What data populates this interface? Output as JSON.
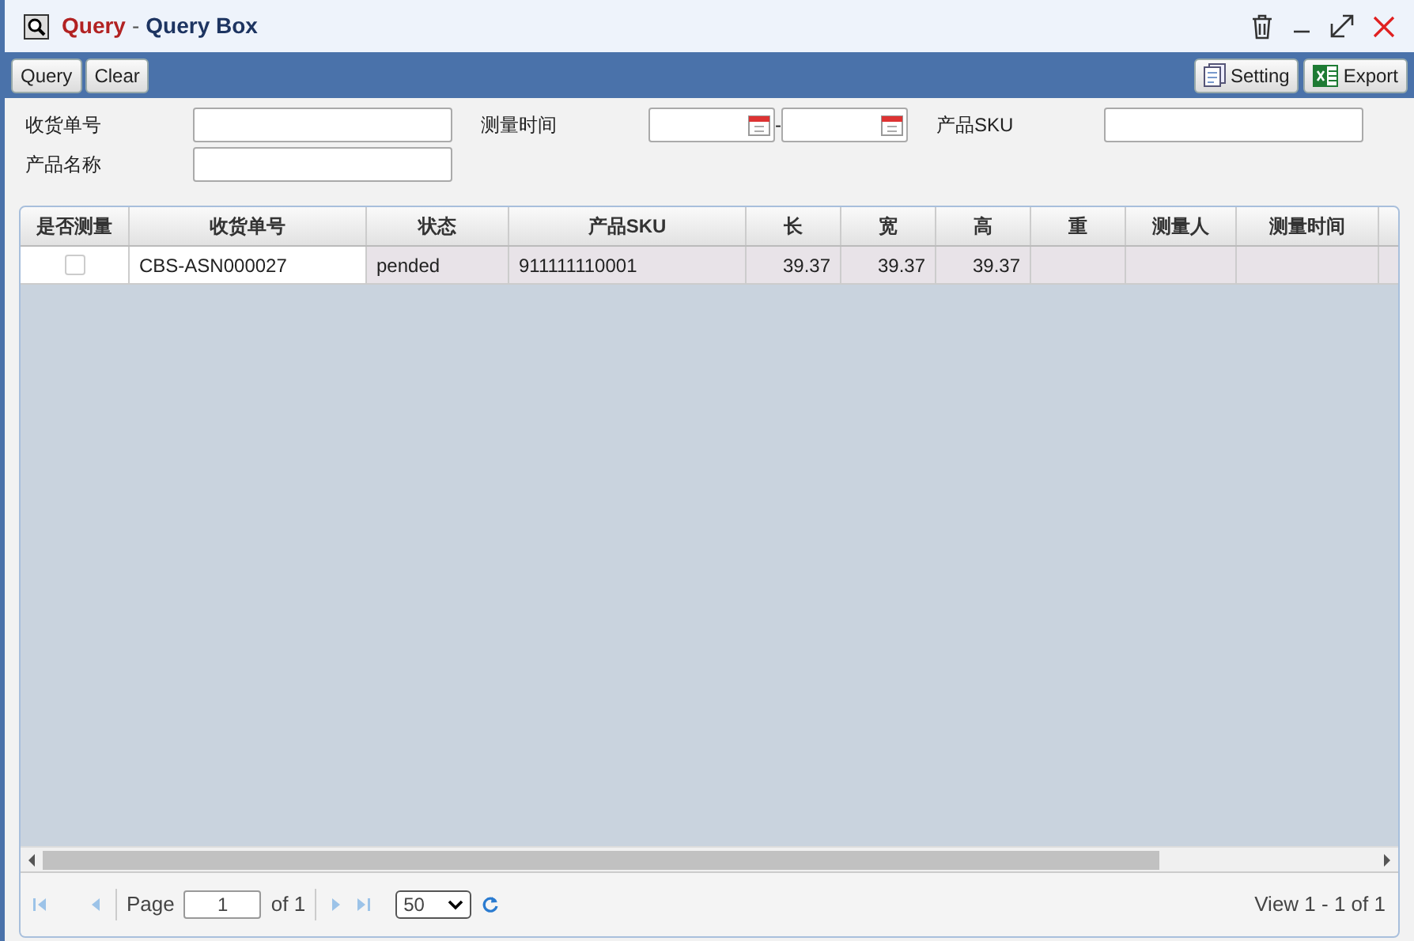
{
  "window": {
    "title_module": "Query",
    "title_separator": "-",
    "title": "Query Box"
  },
  "toolbar": {
    "left": [
      "Query",
      "Clear"
    ],
    "right": [
      {
        "label": "Setting",
        "kind": "setting"
      },
      {
        "label": "Export",
        "kind": "export"
      }
    ]
  },
  "filters": [
    {
      "label": "收货单号",
      "kind": "text"
    },
    {
      "label": "测量时间",
      "kind": "daterange",
      "separator": "-"
    },
    {
      "label": "产品SKU",
      "kind": "text"
    },
    {
      "label": "产品名称",
      "kind": "text"
    }
  ],
  "table": {
    "columns": [
      "是否测量",
      "收货单号",
      "状态",
      "产品SKU",
      "长",
      "宽",
      "高",
      "重",
      "测量人",
      "测量时间"
    ],
    "rows": [
      {
        "checked": false,
        "cells": [
          "",
          "CBS-ASN000027",
          "pended",
          "911111110001",
          "39.37",
          "39.37",
          "39.37",
          "",
          "",
          ""
        ]
      }
    ]
  },
  "pager": {
    "page_label": "Page",
    "page": "1",
    "of_label": "of 1",
    "page_size": "50",
    "summary": "View 1 - 1 of 1"
  }
}
